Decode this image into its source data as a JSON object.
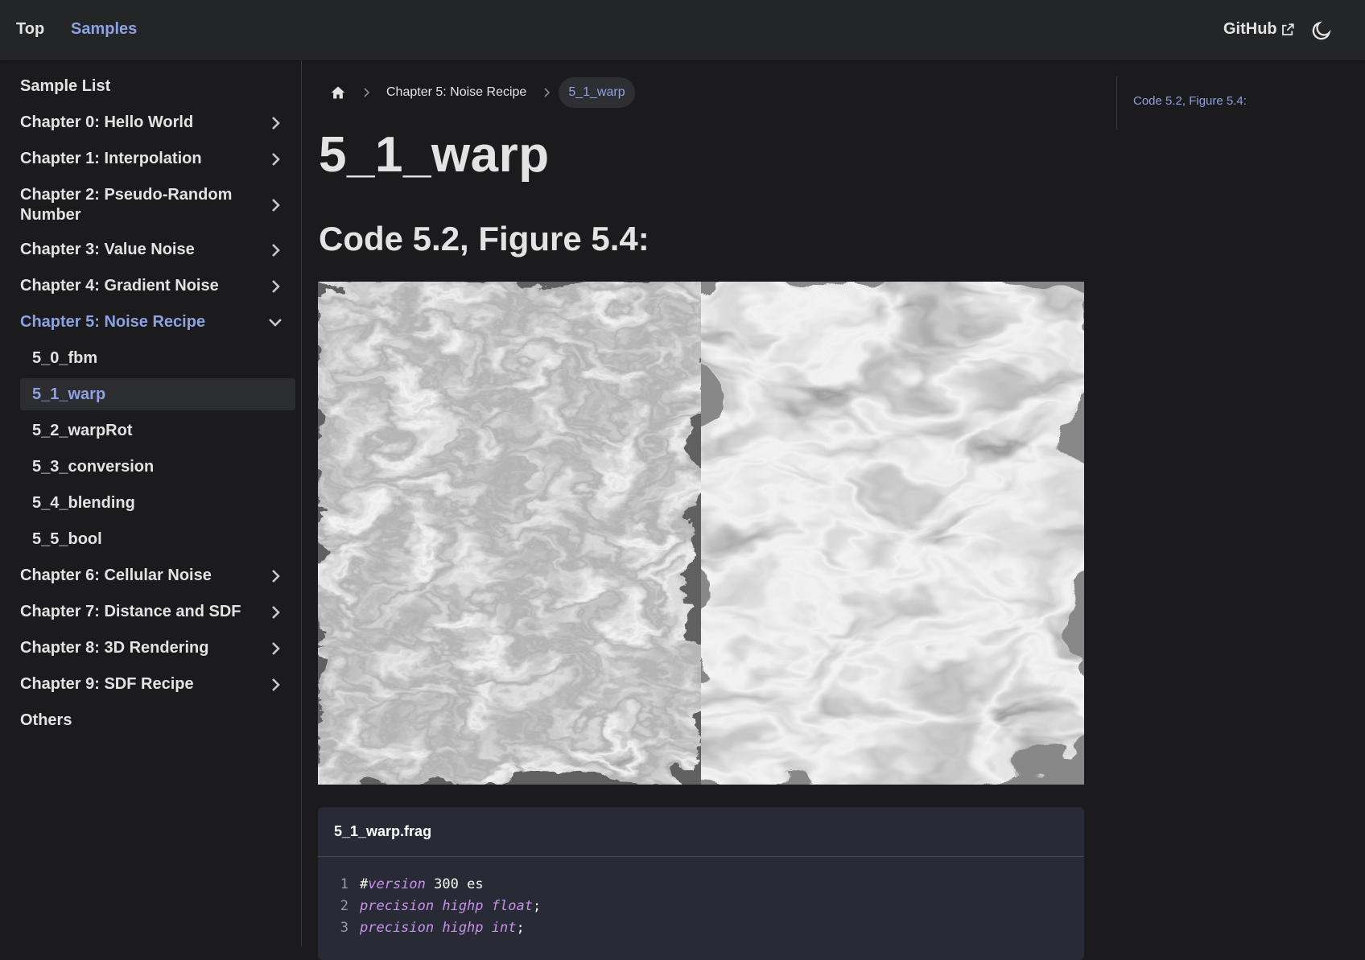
{
  "navbar": {
    "top_label": "Top",
    "samples_label": "Samples",
    "github_label": "GitHub",
    "theme_icon": "moon-icon"
  },
  "sidebar": {
    "title": "Sample List",
    "items": [
      {
        "label": "Chapter 0: Hello World",
        "expanded": false
      },
      {
        "label": "Chapter 1: Interpolation",
        "expanded": false
      },
      {
        "label": "Chapter 2: Pseudo-Random Number",
        "expanded": false
      },
      {
        "label": "Chapter 3: Value Noise",
        "expanded": false
      },
      {
        "label": "Chapter 4: Gradient Noise",
        "expanded": false
      },
      {
        "label": "Chapter 5: Noise Recipe",
        "expanded": true
      },
      {
        "label": "Chapter 6: Cellular Noise",
        "expanded": false
      },
      {
        "label": "Chapter 7: Distance and SDF",
        "expanded": false
      },
      {
        "label": "Chapter 8: 3D Rendering",
        "expanded": false
      },
      {
        "label": "Chapter 9: SDF Recipe",
        "expanded": false
      }
    ],
    "sub_items": [
      {
        "label": "5_0_fbm"
      },
      {
        "label": "5_1_warp",
        "active": true
      },
      {
        "label": "5_2_warpRot"
      },
      {
        "label": "5_3_conversion"
      },
      {
        "label": "5_4_blending"
      },
      {
        "label": "5_5_bool"
      }
    ],
    "others_label": "Others"
  },
  "breadcrumb": {
    "home_icon": "home-icon",
    "chapter": "Chapter 5: Noise Recipe",
    "current": "5_1_warp"
  },
  "main": {
    "title": "5_1_warp",
    "section_heading": "Code 5.2, Figure 5.4:"
  },
  "code": {
    "filename": "5_1_warp.frag",
    "lines": [
      {
        "num": "1",
        "prefix": "#",
        "kw": "version",
        "rest": " 300 es"
      },
      {
        "num": "2",
        "prefix": "",
        "kw": "precision highp float",
        "rest": ";"
      },
      {
        "num": "3",
        "prefix": "",
        "kw": "precision highp int",
        "rest": ";"
      }
    ]
  },
  "toc": {
    "link": "Code 5.2, Figure 5.4:"
  },
  "colors": {
    "accent": "#8ea1e1",
    "background": "#1b1b1d",
    "navbar": "#242526",
    "code_bg": "#282a36"
  }
}
